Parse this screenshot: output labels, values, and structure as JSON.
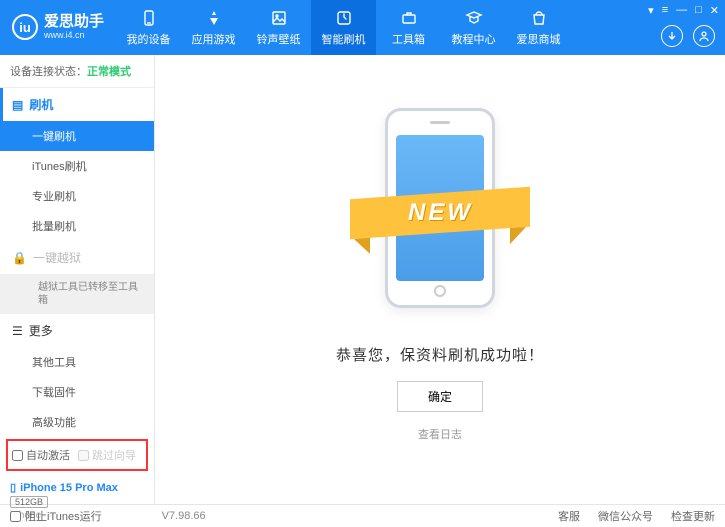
{
  "header": {
    "logo_badge": "iu",
    "title": "爱思助手",
    "subtitle": "www.i4.cn",
    "nav": [
      {
        "label": "我的设备"
      },
      {
        "label": "应用游戏"
      },
      {
        "label": "铃声壁纸"
      },
      {
        "label": "智能刷机"
      },
      {
        "label": "工具箱"
      },
      {
        "label": "教程中心"
      },
      {
        "label": "爱思商城"
      }
    ],
    "window_controls": [
      "▾",
      "≡",
      "—",
      "□",
      "✕"
    ]
  },
  "sidebar": {
    "status_label": "设备连接状态：",
    "status_value": "正常模式",
    "section_flash": "刷机",
    "items_flash": [
      "一键刷机",
      "iTunes刷机",
      "专业刷机",
      "批量刷机"
    ],
    "section_jailbreak": "一键越狱",
    "jailbreak_note": "越狱工具已转移至工具箱",
    "section_more": "更多",
    "items_more": [
      "其他工具",
      "下载固件",
      "高级功能"
    ],
    "checks": {
      "auto_activate": "自动激活",
      "skip_setup": "跳过向导"
    },
    "device": {
      "name": "iPhone 15 Pro Max",
      "storage": "512GB",
      "type": "iPhone"
    }
  },
  "main": {
    "ribbon": "NEW",
    "success": "恭喜您，保资料刷机成功啦！",
    "ok": "确定",
    "log": "查看日志"
  },
  "footer": {
    "block_itunes": "阻止iTunes运行",
    "version": "V7.98.66",
    "links": [
      "客服",
      "微信公众号",
      "检查更新"
    ]
  }
}
